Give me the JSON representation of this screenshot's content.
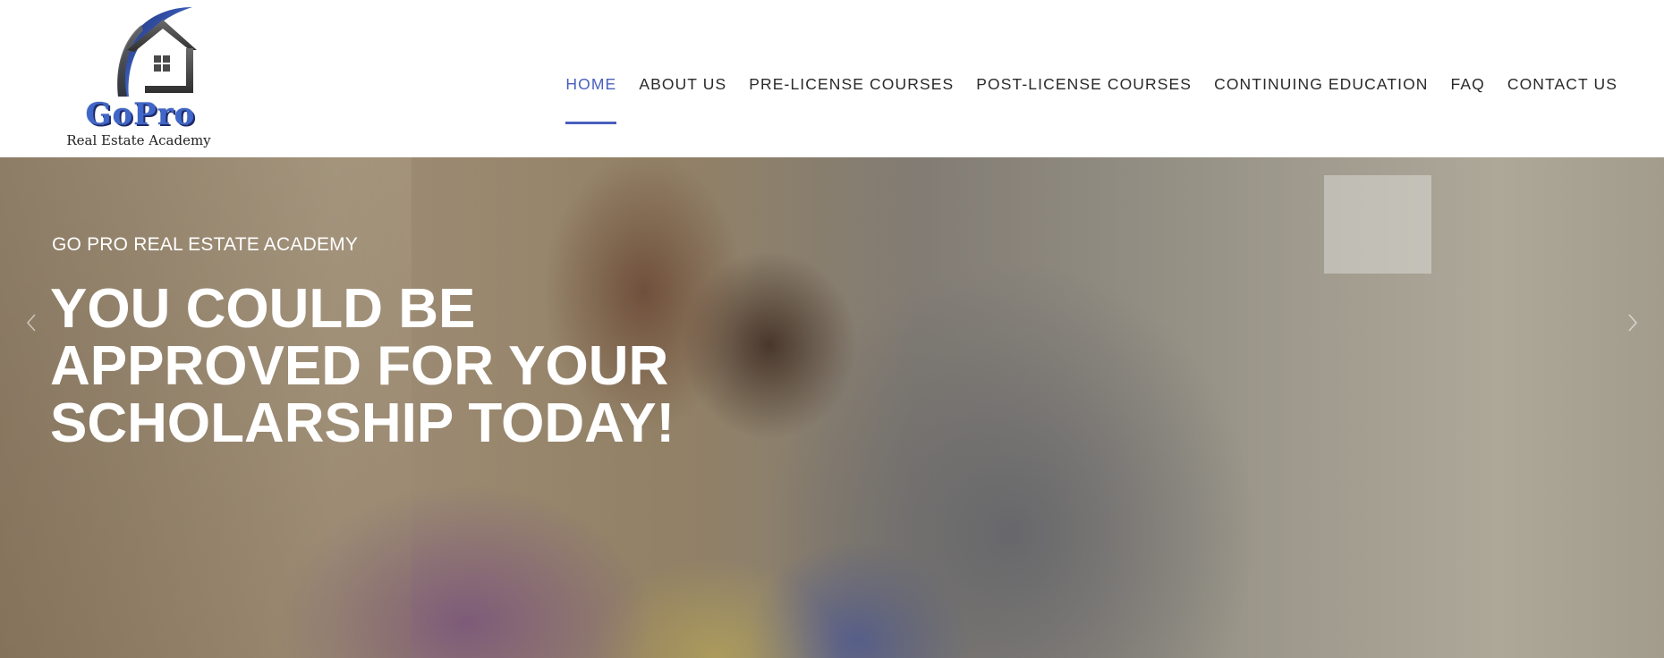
{
  "brand": {
    "name": "GoPro",
    "tagline": "Real Estate Academy",
    "logo_colors": {
      "arc": "#3f66c9",
      "house": "#4a4a4a"
    }
  },
  "nav": {
    "items": [
      {
        "label": "HOME",
        "active": true
      },
      {
        "label": "ABOUT US",
        "active": false
      },
      {
        "label": "PRE-LICENSE COURSES",
        "active": false
      },
      {
        "label": "POST-LICENSE COURSES",
        "active": false
      },
      {
        "label": "CONTINUING EDUCATION",
        "active": false
      },
      {
        "label": "FAQ",
        "active": false
      },
      {
        "label": "CONTACT US",
        "active": false
      }
    ],
    "active_color": "#4a5fbf"
  },
  "hero": {
    "eyebrow": "GO PRO REAL ESTATE ACADEMY",
    "heading_lines": [
      "YOU COULD BE",
      "APPROVED FOR YOUR",
      "SCHOLARSHIP TODAY!"
    ],
    "prev_icon": "chevron-left-icon",
    "next_icon": "chevron-right-icon"
  }
}
